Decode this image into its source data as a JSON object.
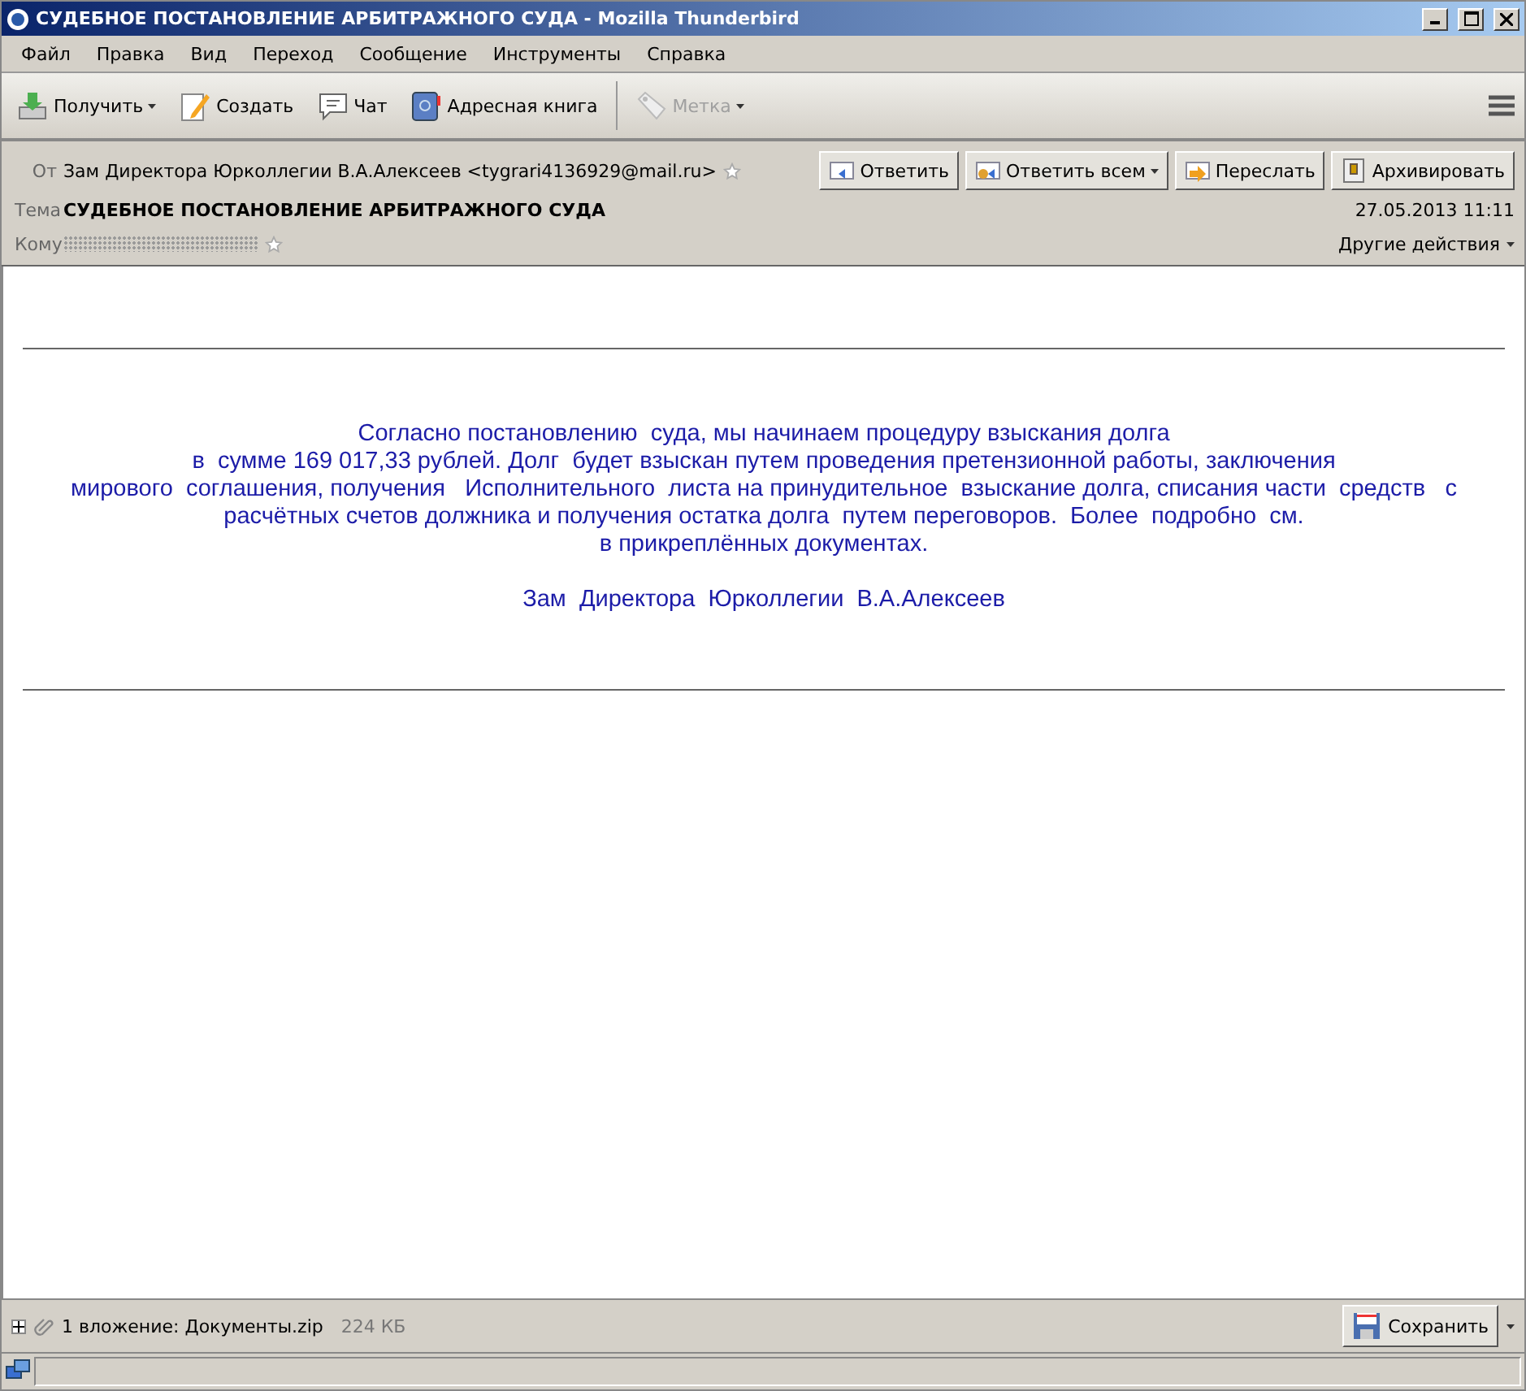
{
  "window": {
    "title": "СУДЕБНОЕ ПОСТАНОВЛЕНИЕ АРБИТРАЖНОГО СУДА - Mozilla Thunderbird"
  },
  "menu": [
    "Файл",
    "Правка",
    "Вид",
    "Переход",
    "Сообщение",
    "Инструменты",
    "Справка"
  ],
  "toolbar": [
    {
      "label": "Получить",
      "kind": "get",
      "dropdown": true,
      "disabled": false
    },
    {
      "label": "Создать",
      "kind": "write",
      "dropdown": false,
      "disabled": false
    },
    {
      "label": "Чат",
      "kind": "chat",
      "dropdown": false,
      "disabled": false
    },
    {
      "label": "Адресная книга",
      "kind": "book",
      "dropdown": false,
      "disabled": false
    },
    {
      "label": "Метка",
      "kind": "tag",
      "dropdown": true,
      "disabled": true
    }
  ],
  "header": {
    "from_label": "От",
    "from": "Зам Директора Юрколлегии В.А.Алексеев <tygrari4136929@mail.ru>",
    "subject_label": "Тема",
    "subject": "СУДЕБНОЕ ПОСТАНОВЛЕНИЕ АРБИТРАЖНОГО СУДА",
    "to_label": "Кому",
    "date": "27.05.2013 11:11",
    "other_actions": "Другие действия",
    "buttons": [
      {
        "label": "Ответить",
        "kind": "reply",
        "dropdown": false
      },
      {
        "label": "Ответить всем",
        "kind": "replyall",
        "dropdown": true
      },
      {
        "label": "Переслать",
        "kind": "forward",
        "dropdown": false
      },
      {
        "label": "Архивировать",
        "kind": "archive",
        "dropdown": false
      }
    ]
  },
  "body": {
    "lines": [
      "Согласно постановлению  суда, мы начинаем процедуру взыскания долга",
      "в  сумме 169 017,33 рублей. Долг  будет взыскан путем проведения претензионной работы, заключения",
      "мирового  соглашения, получения   Исполнительного  листа на принудительное  взыскание долга, списания части  средств   с",
      "расчётных счетов должника и получения остатка долга  путем переговоров.  Более  подробно  см.",
      "в прикреплённых документах."
    ],
    "signature": "Зам  Директора  Юрколлегии  В.А.Алексеев"
  },
  "attachments": {
    "expanded": false,
    "summary": "1 вложение: Документы.zip",
    "size": "224 КБ",
    "save": "Сохранить"
  }
}
